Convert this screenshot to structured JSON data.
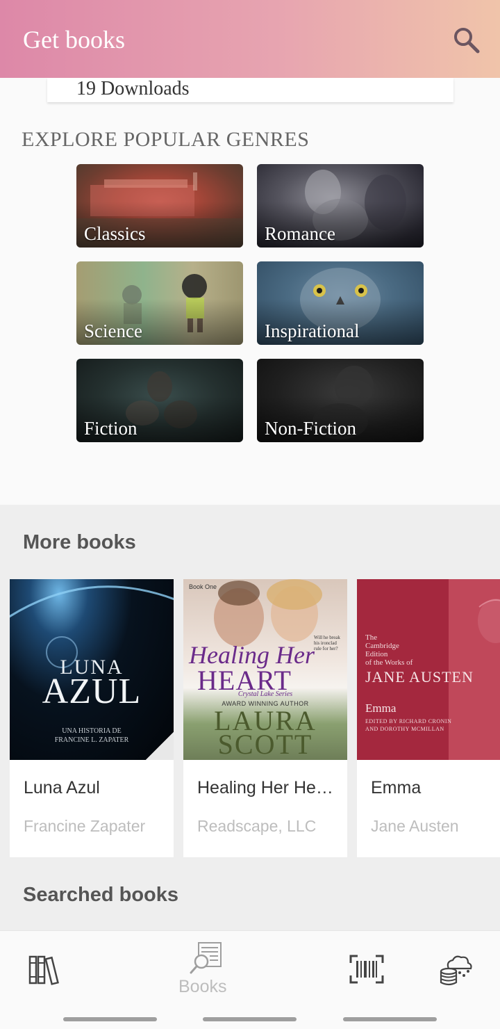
{
  "appbar": {
    "title": "Get books",
    "search_icon": "search-icon",
    "gradient": [
      "#dd88a8",
      "#f0c4aa"
    ]
  },
  "downloads_card": {
    "text": "19 Downloads"
  },
  "genres": {
    "heading": "EXPLORE POPULAR GENRES",
    "items": [
      {
        "label": "Classics"
      },
      {
        "label": "Romance"
      },
      {
        "label": "Science"
      },
      {
        "label": "Inspirational"
      },
      {
        "label": "Fiction"
      },
      {
        "label": "Non-Fiction"
      }
    ]
  },
  "more_books": {
    "title": "More books",
    "items": [
      {
        "title": "Luna Azul",
        "author": "Francine Zapater",
        "cover": {
          "line1": "LUNA",
          "line2": "AZUL",
          "tagline": "UNA HISTORIA DE",
          "byline": "FRANCINE L. ZAPATER"
        }
      },
      {
        "title": "Healing Her He…",
        "author": "Readscape, LLC",
        "cover": {
          "series_top": "Book One",
          "word1": "Healing Her",
          "word2": "HEART",
          "series": "Crystal Lake Series",
          "badge": "AWARD WINNING AUTHOR",
          "author1": "LAURA",
          "author2": "SCOTT",
          "quote": "Will he break his ironclad rule for her?"
        }
      },
      {
        "title": "Emma",
        "author": "Jane Austen",
        "cover": {
          "edition_1": "The",
          "edition_2": "Cambridge",
          "edition_3": "Edition",
          "edition_4": "of the Works of",
          "name": "JANE AUSTEN",
          "book": "Emma",
          "editors_1": "EDITED BY RICHARD CRONIN",
          "editors_2": "AND DOROTHY MCMILLAN"
        }
      }
    ]
  },
  "searched_books": {
    "title": "Searched books"
  },
  "bottom_nav": {
    "items": [
      {
        "icon": "bookshelf-icon"
      },
      {
        "icon": "book-search-icon",
        "label": "Books"
      },
      {
        "icon": "barcode-scan-icon"
      },
      {
        "icon": "cloud-database-icon"
      }
    ]
  }
}
